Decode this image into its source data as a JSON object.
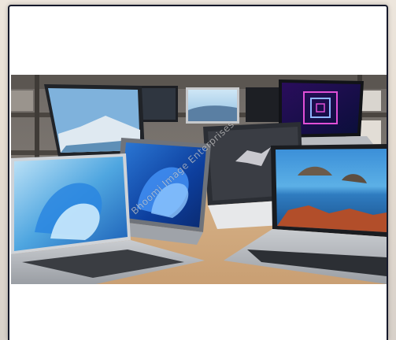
{
  "image": {
    "alt": "",
    "watermark_text": "Bhoomi Image Enterprises"
  },
  "colors": {
    "card_border": "#15192b",
    "card_background": "#ffffff",
    "page_background": "#e9e1d7"
  }
}
